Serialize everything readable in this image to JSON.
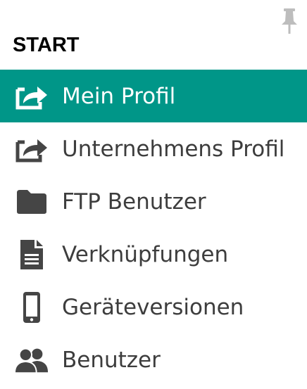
{
  "header": {
    "section_title": "START",
    "pin_icon": "pin-icon"
  },
  "menu": {
    "items": [
      {
        "label": "Mein Profil",
        "icon": "share-icon",
        "active": true
      },
      {
        "label": "Unternehmens Profil",
        "icon": "share-icon",
        "active": false
      },
      {
        "label": "FTP Benutzer",
        "icon": "folder-icon",
        "active": false
      },
      {
        "label": "Verknüpfungen",
        "icon": "document-icon",
        "active": false
      },
      {
        "label": "Geräteversionen",
        "icon": "mobile-phone-icon",
        "active": false
      },
      {
        "label": "Benutzer",
        "icon": "users-icon",
        "active": false
      }
    ]
  },
  "colors": {
    "accent": "#009688",
    "text": "#3d3d3d",
    "icon": "#454545",
    "pin": "#bdbdbd"
  }
}
